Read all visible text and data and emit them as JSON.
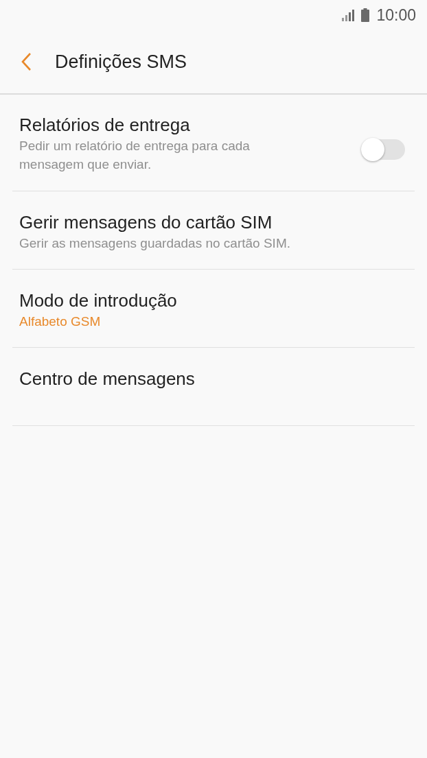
{
  "status_bar": {
    "time": "10:00"
  },
  "header": {
    "title": "Definições SMS"
  },
  "settings": [
    {
      "kind": "toggle",
      "title": "Relatórios de entrega",
      "summary": "Pedir um relatório de entrega para cada mensagem que enviar.",
      "on": false
    },
    {
      "kind": "plain",
      "title": "Gerir mensagens do cartão SIM",
      "summary": "Gerir as mensagens guardadas no cartão SIM."
    },
    {
      "kind": "plain",
      "title": "Modo de introdução",
      "value": "Alfabeto GSM"
    },
    {
      "kind": "plain",
      "title": "Centro de mensagens"
    }
  ]
}
